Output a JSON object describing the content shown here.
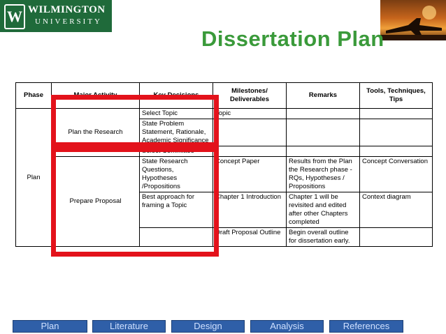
{
  "header": {
    "logo_name": "WILMINGTON",
    "logo_sub": "UNIVERSITY",
    "logo_mark": "W",
    "title": "Dissertation Plan"
  },
  "table": {
    "headers": [
      "Phase",
      "Major Activity",
      "Key Decisions",
      "Milestones/ Deliverables",
      "Remarks",
      "Tools, Techniques, Tips"
    ],
    "phase": "Plan",
    "activities": [
      "Plan the Research",
      "Prepare Proposal"
    ],
    "decisions": [
      "Select Topic",
      "State Problem Statement, Rationale, Academic Significance",
      "Select Committee",
      "State Research Questions, Hypotheses /Propositions",
      "Best approach for framing a Topic",
      ""
    ],
    "milestones": [
      "Topic",
      "",
      "",
      "Concept Paper",
      "Chapter 1 Introduction",
      "Draft Proposal Outline"
    ],
    "remarks": [
      "",
      "",
      "",
      "Results from the Plan the Research phase - RQs, Hypotheses / Propositions",
      "Chapter 1 will be revisited and edited after other Chapters completed",
      "Begin overall outline for dissertation early."
    ],
    "tools": [
      "",
      "",
      "",
      "Concept Conversation",
      "Context diagram",
      ""
    ]
  },
  "nav": [
    "Plan",
    "Literature",
    "Design",
    "Analysis",
    "References"
  ],
  "colors": {
    "title": "#3a9a3a",
    "highlight": "#e3121b",
    "nav_bg": "#2f5fa8",
    "logo_bg": "#1f6a3a"
  }
}
